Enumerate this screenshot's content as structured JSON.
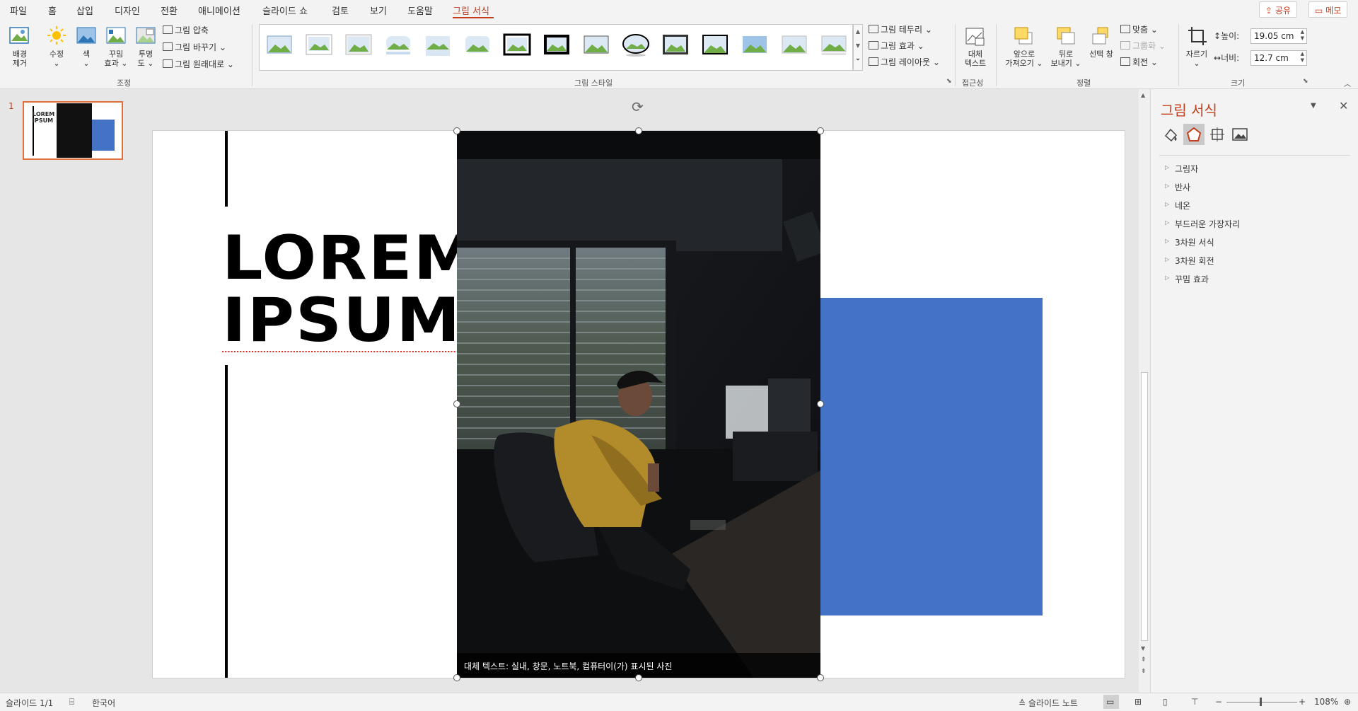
{
  "menu": {
    "items": [
      "파일",
      "홈",
      "삽입",
      "디자인",
      "전환",
      "애니메이션",
      "슬라이드 쇼",
      "검토",
      "보기",
      "도움말",
      "그림 서식"
    ],
    "active": "그림 서식",
    "share": "공유",
    "memo": "메모"
  },
  "ribbon": {
    "adjust": {
      "remove_bg": [
        "배경",
        "제거"
      ],
      "corrections": "수정",
      "color": "색",
      "artistic": [
        "꾸밈",
        "효과"
      ],
      "transparency": [
        "투명",
        "도"
      ],
      "compress": "그림 압축",
      "change": "그림 바꾸기",
      "reset": "그림 원래대로",
      "group_label": "조정"
    },
    "styles": {
      "group_label": "그림 스타일",
      "border": "그림 테두리",
      "effects": "그림 효과",
      "layout": "그림 레이아웃"
    },
    "accessibility": {
      "alt_text": [
        "대체",
        "텍스트"
      ],
      "group_label": "접근성"
    },
    "arrange": {
      "bring_forward": [
        "앞으로",
        "가져오기"
      ],
      "send_backward": [
        "뒤로",
        "보내기"
      ],
      "selection_pane": "선택 창",
      "align": "맞춤",
      "group": "그룹화",
      "rotate": "회전",
      "group_label": "정렬"
    },
    "size": {
      "crop": "자르기",
      "height_label": "높이:",
      "height_value": "19.05 cm",
      "width_label": "너비:",
      "width_value": "12.7 cm",
      "group_label": "크기"
    }
  },
  "thumbnails": {
    "number": "1",
    "text_line1": "LOREM",
    "text_line2": "IPSUM"
  },
  "slide": {
    "title_line1": "LOREM",
    "title_line2": "IPSUM",
    "alt_text_caption": "대체 텍스트: 실내, 창문, 노트북, 컴퓨터이(가) 표시된 사진",
    "rect_color": "#4472c4"
  },
  "taskpane": {
    "title": "그림 서식",
    "sections": [
      "그림자",
      "반사",
      "네온",
      "부드러운 가장자리",
      "3차원 서식",
      "3차원 회전",
      "꾸밈 효과"
    ]
  },
  "status": {
    "slide": "슬라이드 1/1",
    "language": "한국어",
    "notes": "슬라이드 노트",
    "zoom": "108%"
  },
  "colors": {
    "accent": "#c43e1c",
    "shape_blue": "#4472c4"
  }
}
